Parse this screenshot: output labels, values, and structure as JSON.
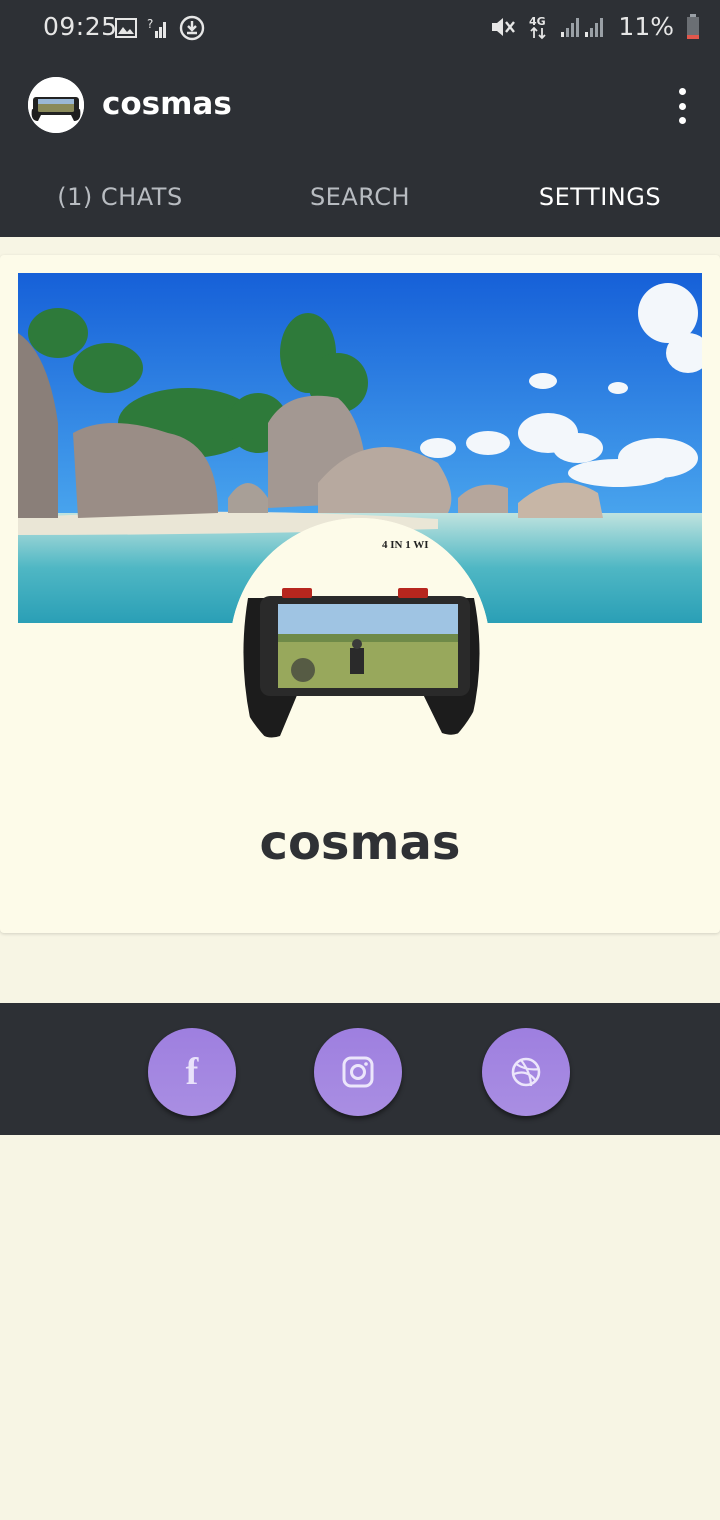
{
  "status_bar": {
    "time": "09:25",
    "battery": "11%",
    "network": "4G",
    "icons": [
      "image-icon",
      "no-signal-icon",
      "download-icon",
      "mute-icon",
      "signal-icon",
      "battery-icon"
    ]
  },
  "app_bar": {
    "title": "cosmas",
    "avatar": "avatar-icon",
    "menu_icon": "more-vert-icon"
  },
  "tabs": [
    {
      "label": "(1) CHATS",
      "active": false
    },
    {
      "label": "SEARCH",
      "active": false
    },
    {
      "label": "SETTINGS",
      "active": true
    }
  ],
  "profile": {
    "name": "cosmas",
    "cover_image": "beach-cover-image",
    "profile_image": "game-controller-image",
    "profile_image_caption": "4 IN 1 WI"
  },
  "social": [
    {
      "name": "facebook",
      "icon": "facebook-icon"
    },
    {
      "name": "instagram",
      "icon": "instagram-icon"
    },
    {
      "name": "dribbble",
      "icon": "dribbble-icon"
    }
  ],
  "colors": {
    "bar": "#2d3035",
    "page_bg": "#f7f5e4",
    "card_bg": "#fdfbe9",
    "accent": "#9e7fe0",
    "name_text": "#2f3135"
  }
}
